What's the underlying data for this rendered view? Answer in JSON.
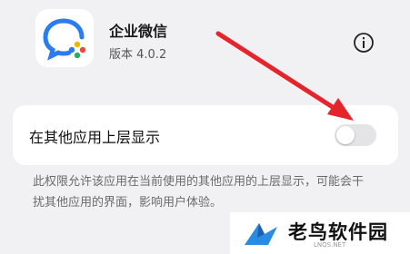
{
  "app": {
    "name": "企业微信",
    "version": "版本 4.0.2",
    "icon": "wecom-logo-icon"
  },
  "header": {
    "info_icon": "info-icon"
  },
  "setting": {
    "label": "在其他应用上层显示",
    "enabled": false
  },
  "description": "此权限允许该应用在当前使用的其他应用的上层显示，可能会干扰其他应用的界面，影响用户体验。",
  "watermark": {
    "text": "老鸟软件园",
    "subtext": "LNQS.NET"
  },
  "colors": {
    "accent_arrow": "#e5242b",
    "logo_blue": "#2b7cf0",
    "background": "#f1f1f3"
  }
}
